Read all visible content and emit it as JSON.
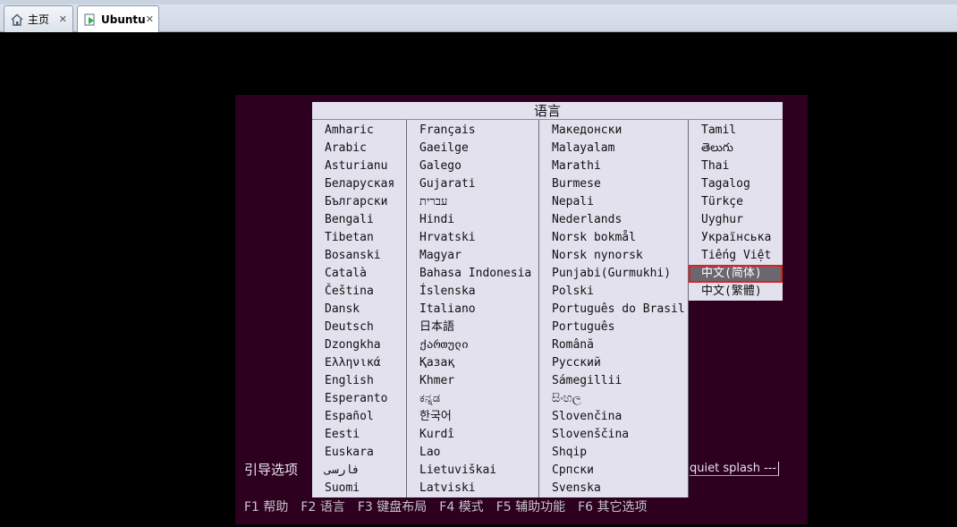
{
  "tabs": [
    {
      "label": "主页",
      "icon": "home-icon"
    },
    {
      "label": "Ubuntu",
      "icon": "vm-icon",
      "active": true
    }
  ],
  "menu": {
    "title": "语言",
    "columns": [
      [
        "Amharic",
        "Arabic",
        "Asturianu",
        "Беларуская",
        "Български",
        "Bengali",
        "Tibetan",
        "Bosanski",
        "Català",
        "Čeština",
        "Dansk",
        "Deutsch",
        "Dzongkha",
        "Ελληνικά",
        "English",
        "Esperanto",
        "Español",
        "Eesti",
        "Euskara",
        "فارسی",
        "Suomi"
      ],
      [
        "Français",
        "Gaeilge",
        "Galego",
        "Gujarati",
        "עברית",
        "Hindi",
        "Hrvatski",
        "Magyar",
        "Bahasa Indonesia",
        "Íslenska",
        "Italiano",
        "日本語",
        "ქართული",
        "Қазақ",
        "Khmer",
        "ಕನ್ನಡ",
        "한국어",
        "Kurdî",
        "Lao",
        "Lietuviškai",
        "Latviski"
      ],
      [
        "Македонски",
        "Malayalam",
        "Marathi",
        "Burmese",
        "Nepali",
        "Nederlands",
        "Norsk bokmål",
        "Norsk nynorsk",
        "Punjabi(Gurmukhi)",
        "Polski",
        "Português do Brasil",
        "Português",
        "Română",
        "Русский",
        "Sámegillii",
        "සිංහල",
        "Slovenčina",
        "Slovenščina",
        "Shqip",
        "Српски",
        "Svenska"
      ],
      [
        "Tamil",
        "తెలుగు",
        "Thai",
        "Tagalog",
        "Türkçe",
        "Uyghur",
        "Українська",
        "Tiếng Việt",
        "中文(简体)",
        "中文(繁體)"
      ]
    ],
    "selected": "中文(简体)"
  },
  "boot_options": {
    "label": "引导选项",
    "cmdline": "quiet splash ---"
  },
  "fkeys": [
    {
      "key": "F1",
      "label": "帮助"
    },
    {
      "key": "F2",
      "label": "语言"
    },
    {
      "key": "F3",
      "label": "键盘布局"
    },
    {
      "key": "F4",
      "label": "模式"
    },
    {
      "key": "F5",
      "label": "辅助功能"
    },
    {
      "key": "F6",
      "label": "其它选项"
    }
  ],
  "colors": {
    "boot_background": "#2c001e",
    "menu_background": "#e3e1ee",
    "selected_background": "#6b6670",
    "highlight_border": "#e02020"
  }
}
